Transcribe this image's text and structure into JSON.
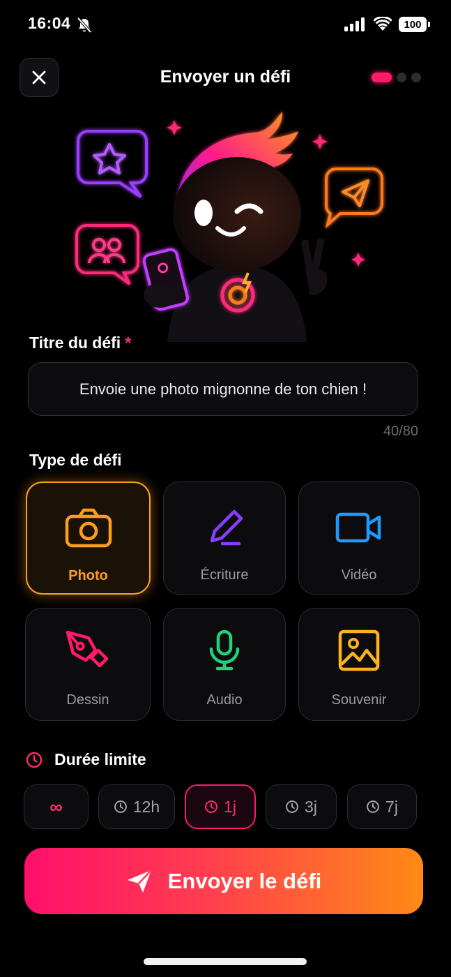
{
  "status_bar": {
    "time": "16:04",
    "battery": "100"
  },
  "header": {
    "title": "Envoyer un défi",
    "close_icon": "close-icon",
    "step_count": 3,
    "active_step": 1
  },
  "hero": {
    "illustration": "mascot-illustration"
  },
  "title_field": {
    "label": "Titre du défi",
    "required_mark": "*",
    "value": "Envoie une photo mignonne de ton chien !",
    "counter": "40/80"
  },
  "type_section": {
    "label": "Type de défi",
    "options": [
      {
        "label": "Photo",
        "icon": "camera-icon",
        "color": "#ff9e1b",
        "selected": true
      },
      {
        "label": "Écriture",
        "icon": "pencil-icon",
        "color": "#8b3dff",
        "selected": false
      },
      {
        "label": "Vidéo",
        "icon": "video-icon",
        "color": "#1e9bff",
        "selected": false
      },
      {
        "label": "Dessin",
        "icon": "pen-nib-icon",
        "color": "#ff1a6b",
        "selected": false
      },
      {
        "label": "Audio",
        "icon": "microphone-icon",
        "color": "#1fd37a",
        "selected": false
      },
      {
        "label": "Souvenir",
        "icon": "image-icon",
        "color": "#ffb21b",
        "selected": false
      }
    ]
  },
  "duration": {
    "label": "Durée limite",
    "options": [
      {
        "label": "∞",
        "selected": false
      },
      {
        "label": "12h",
        "selected": false
      },
      {
        "label": "1j",
        "selected": true
      },
      {
        "label": "3j",
        "selected": false
      },
      {
        "label": "7j",
        "selected": false
      }
    ]
  },
  "submit": {
    "label": "Envoyer le défi",
    "icon": "send-icon"
  },
  "colors": {
    "accent": "#ff1a6b",
    "gradient_start": "#ff0f6b",
    "gradient_end": "#ff8a15",
    "background": "#000000"
  }
}
